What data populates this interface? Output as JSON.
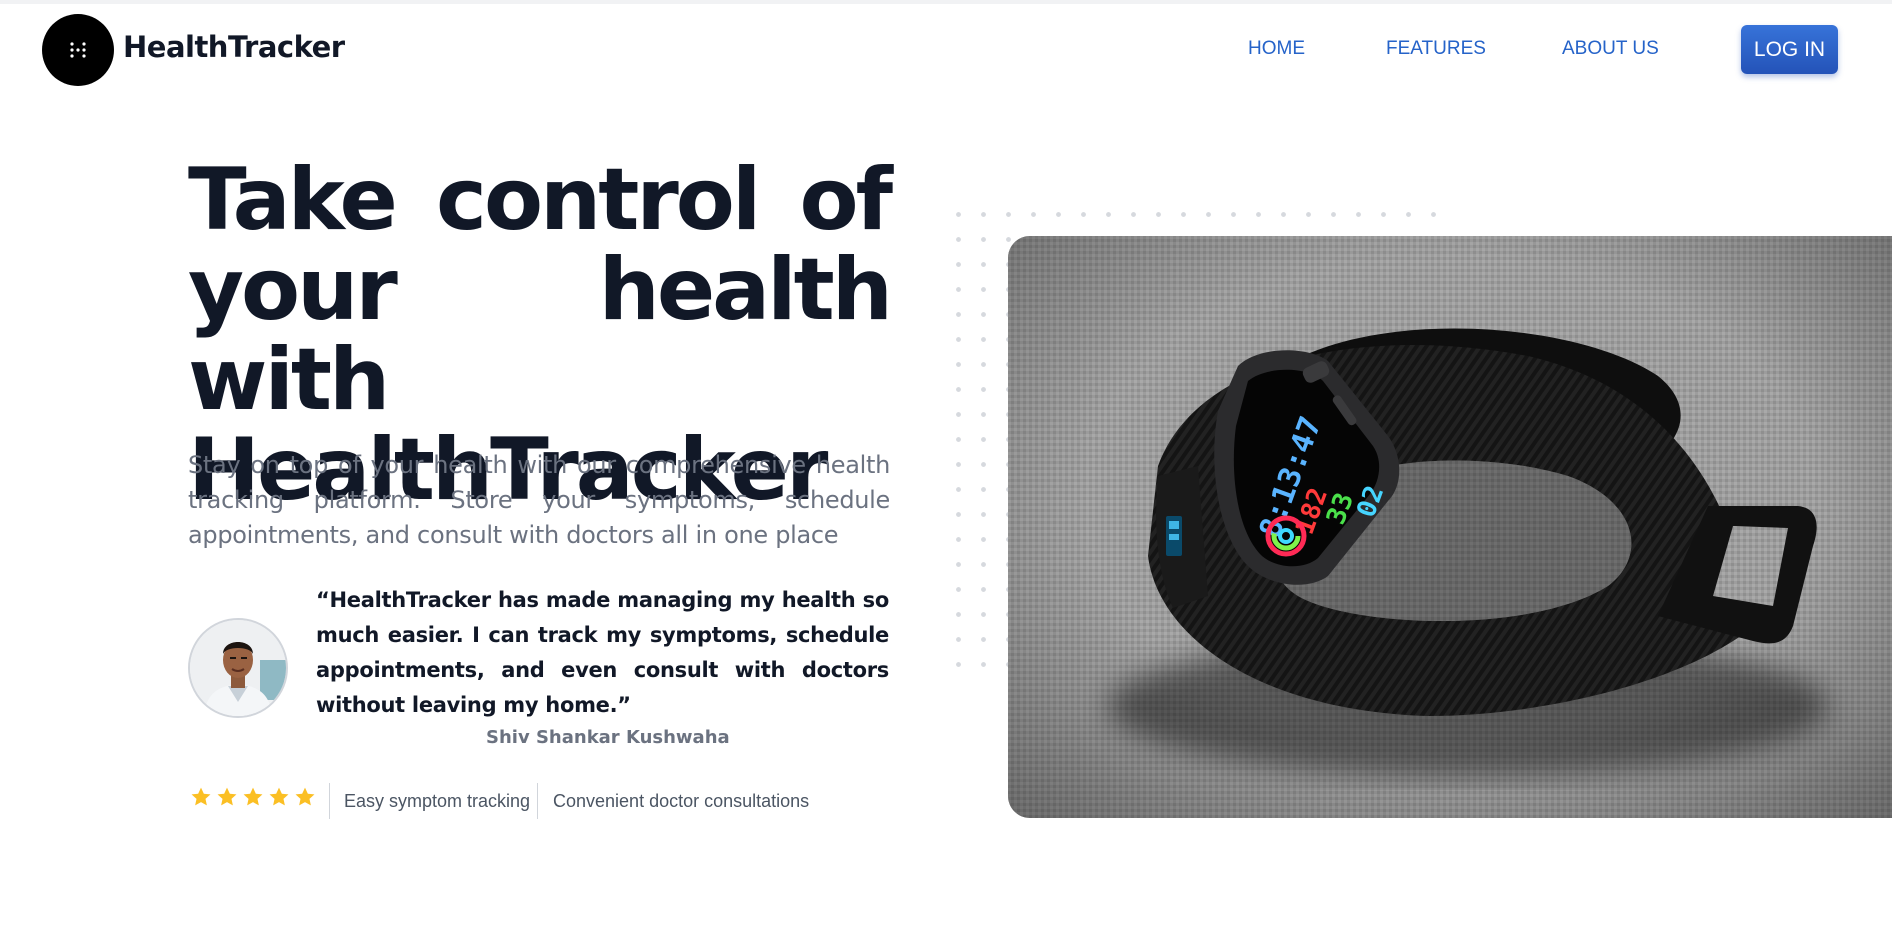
{
  "header": {
    "brand": "HealthTracker",
    "logo_icon": "grid-dots-icon",
    "nav": [
      {
        "label": "HOME"
      },
      {
        "label": "FEATURES"
      },
      {
        "label": "ABOUT US"
      }
    ],
    "login_label": "LOG IN"
  },
  "hero": {
    "title_lines": [
      "Take control of",
      "your health with",
      "HealthTracker"
    ],
    "subtitle": "Stay on top of your health with our comprehensive health tracking platform. Store your symptoms, schedule appointments, and consult with doctors all in one place",
    "testimonial": {
      "quote": "“HealthTracker has made managing my health so much easier. I can track my symptoms, schedule appointments, and even consult with doctors without leaving my home.”",
      "author": "Shiv Shankar Kushwaha"
    },
    "rating": 5,
    "features": [
      "Easy symptom tracking",
      "Convenient doctor consultations"
    ]
  },
  "image": {
    "watch_readout": [
      "8:13:47",
      "182",
      "33",
      "02"
    ]
  },
  "colors": {
    "accent": "#2563c9",
    "heading": "#111827",
    "muted": "#6b7280",
    "star": "#fbbf24",
    "login_bg": "#2b5fc7"
  }
}
